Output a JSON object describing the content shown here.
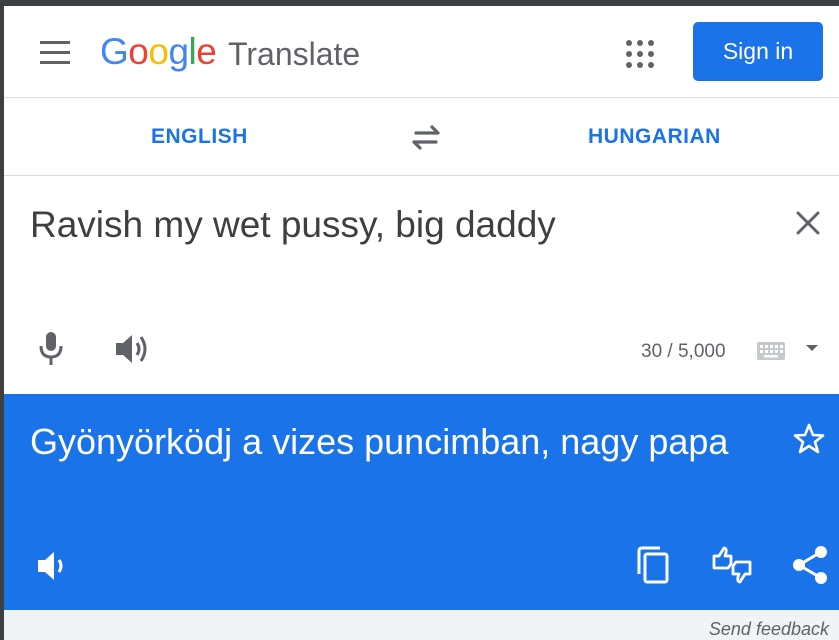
{
  "header": {
    "menu_icon": "hamburger-menu-icon",
    "logo_letters": [
      "G",
      "o",
      "o",
      "g",
      "l",
      "e"
    ],
    "product_name": "Translate",
    "apps_icon": "apps-grid-icon",
    "sign_in_label": "Sign in"
  },
  "languages": {
    "source": "ENGLISH",
    "target": "HUNGARIAN",
    "swap_icon": "swap-arrows-icon"
  },
  "source": {
    "text": "Ravish my wet pussy, big daddy",
    "char_count": "30 / 5,000",
    "icons": [
      "clear-icon",
      "microphone-icon",
      "speaker-icon",
      "keyboard-icon",
      "dropdown-arrow-icon"
    ]
  },
  "translation": {
    "text": "Gyönyörködj a vizes puncimban, nagy papa",
    "icons": [
      "star-icon",
      "speaker-icon",
      "copy-icon",
      "rate-translation-icon",
      "share-icon"
    ]
  },
  "footer": {
    "send_feedback": "Send feedback"
  },
  "colors": {
    "brand_blue": "#1a73e8",
    "logo_blue": "#4285f4",
    "logo_red": "#ea4335",
    "logo_yellow": "#fbbc05",
    "logo_green": "#34a853",
    "icon_gray": "#5f6368"
  }
}
